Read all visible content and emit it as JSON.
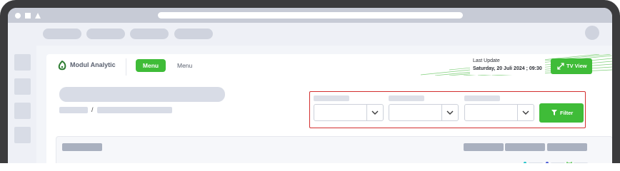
{
  "app": {
    "brand_name": "Modul Analytic"
  },
  "nav": {
    "active_tab_label": "Menu",
    "second_tab_label": "Menu"
  },
  "status": {
    "last_update_label": "Last Update",
    "last_update_value": "Saturday, 20 Juli 2024 ; 09:30"
  },
  "actions": {
    "tv_view_label": "TV View",
    "filter_label": "Filter"
  },
  "breadcrumb": {
    "separator": "/"
  },
  "colors": {
    "accent_green": "#3fbc38",
    "highlight_red": "#d32f2f",
    "legend_teal": "#22c3c9",
    "legend_blue": "#4a5bd6",
    "legend_green": "#3fbc38"
  },
  "icons": {
    "logo": "leaf-logo-icon",
    "tv_view": "expand-arrows-icon",
    "filter": "funnel-icon",
    "select_chevron": "chevron-down-icon"
  }
}
